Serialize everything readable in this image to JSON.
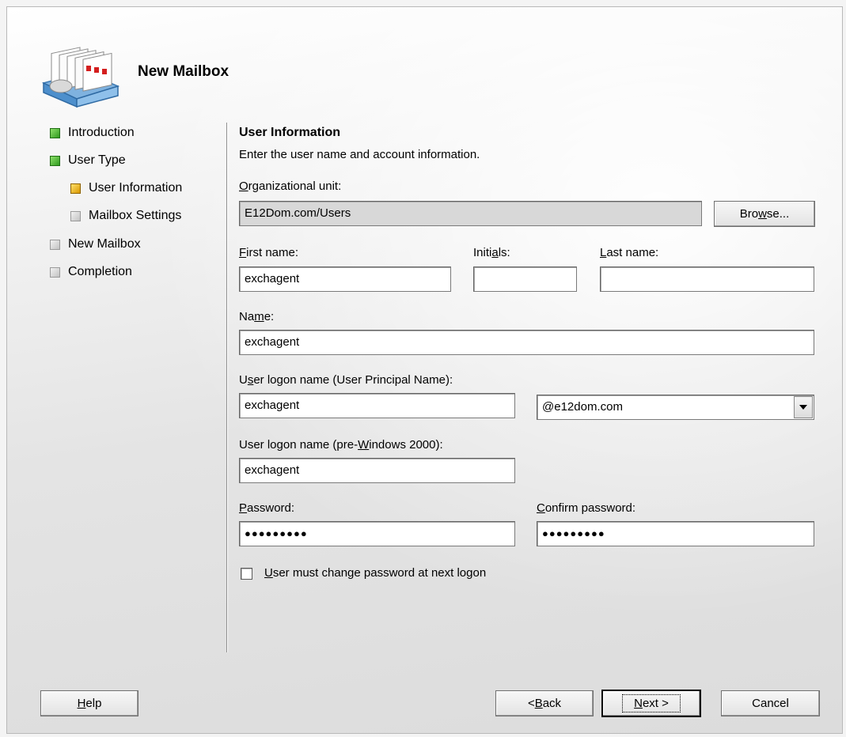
{
  "wizard": {
    "title": "New Mailbox",
    "logo_icon": "mailbox-stack-icon"
  },
  "nav": {
    "items": [
      {
        "label": "Introduction",
        "status": "complete"
      },
      {
        "label": "User Type",
        "status": "complete"
      },
      {
        "label": "User Information",
        "status": "current"
      },
      {
        "label": "Mailbox Settings",
        "status": "pending"
      },
      {
        "label": "New Mailbox",
        "status": "pending"
      },
      {
        "label": "Completion",
        "status": "pending"
      }
    ]
  },
  "section": {
    "title": "User Information",
    "description": "Enter the user name and account information."
  },
  "org_unit": {
    "label_u": "O",
    "label_rest": "rganizational unit:",
    "value": "E12Dom.com/Users",
    "browse_u": "w",
    "browse_pre": "Bro",
    "browse_post": "se..."
  },
  "first_name": {
    "label_u": "F",
    "label_rest": "irst name:",
    "value": "exchagent"
  },
  "initials": {
    "label_pre": "Initi",
    "label_u": "a",
    "label_post": "ls:",
    "value": ""
  },
  "last_name": {
    "label_u": "L",
    "label_rest": "ast name:",
    "value": ""
  },
  "name": {
    "label_pre": "Na",
    "label_u": "m",
    "label_post": "e:",
    "value": "exchagent"
  },
  "upn": {
    "label_pre": "U",
    "label_u": "s",
    "label_post": "er logon name (User Principal Name):",
    "value": "exchagent",
    "domain": "@e12dom.com"
  },
  "pre2000": {
    "label_pre": "User logon name (pre-",
    "label_u": "W",
    "label_post": "indows 2000):",
    "value": "exchagent"
  },
  "password": {
    "label_u": "P",
    "label_rest": "assword:",
    "value": "●●●●●●●●●"
  },
  "confirm_password": {
    "label_u": "C",
    "label_rest": "onfirm password:",
    "value": "●●●●●●●●●"
  },
  "must_change": {
    "label_u": "U",
    "label_rest": "ser must change password at next logon",
    "checked": false
  },
  "buttons": {
    "help_u": "H",
    "help_rest": "elp",
    "back_pre": "< ",
    "back_u": "B",
    "back_rest": "ack",
    "next_u": "N",
    "next_rest": "ext >",
    "cancel": "Cancel"
  }
}
